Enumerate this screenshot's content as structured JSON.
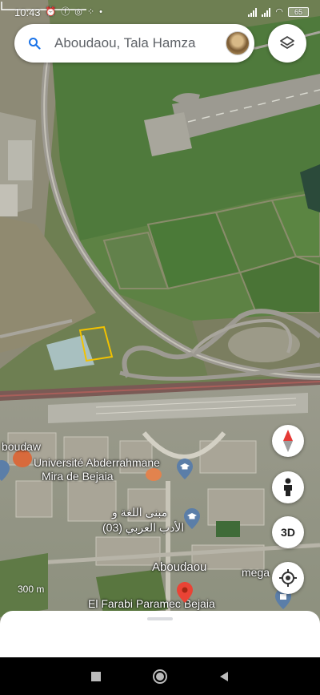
{
  "status_bar": {
    "time": "10:43",
    "battery": "65"
  },
  "search": {
    "placeholder": "Aboudaou, Tala Hamza"
  },
  "map": {
    "labels": {
      "aboudaw": "boudaw",
      "university_line1": "Université Abderrahmane",
      "university_line2": "Mira de Bejaia",
      "arabic_line1": "مبنى اللغة و",
      "arabic_line2": "الأدب العربي (03)",
      "aboudaou": "Aboudaou",
      "mega": "mega",
      "el_farabi": "El Farabi Paramec Bejaia"
    },
    "scale": "300 m"
  },
  "controls": {
    "three_d": "3D"
  },
  "colors": {
    "accent_blue": "#1a73e8",
    "pin_red": "#ea4335",
    "compass_red": "#e53935"
  }
}
